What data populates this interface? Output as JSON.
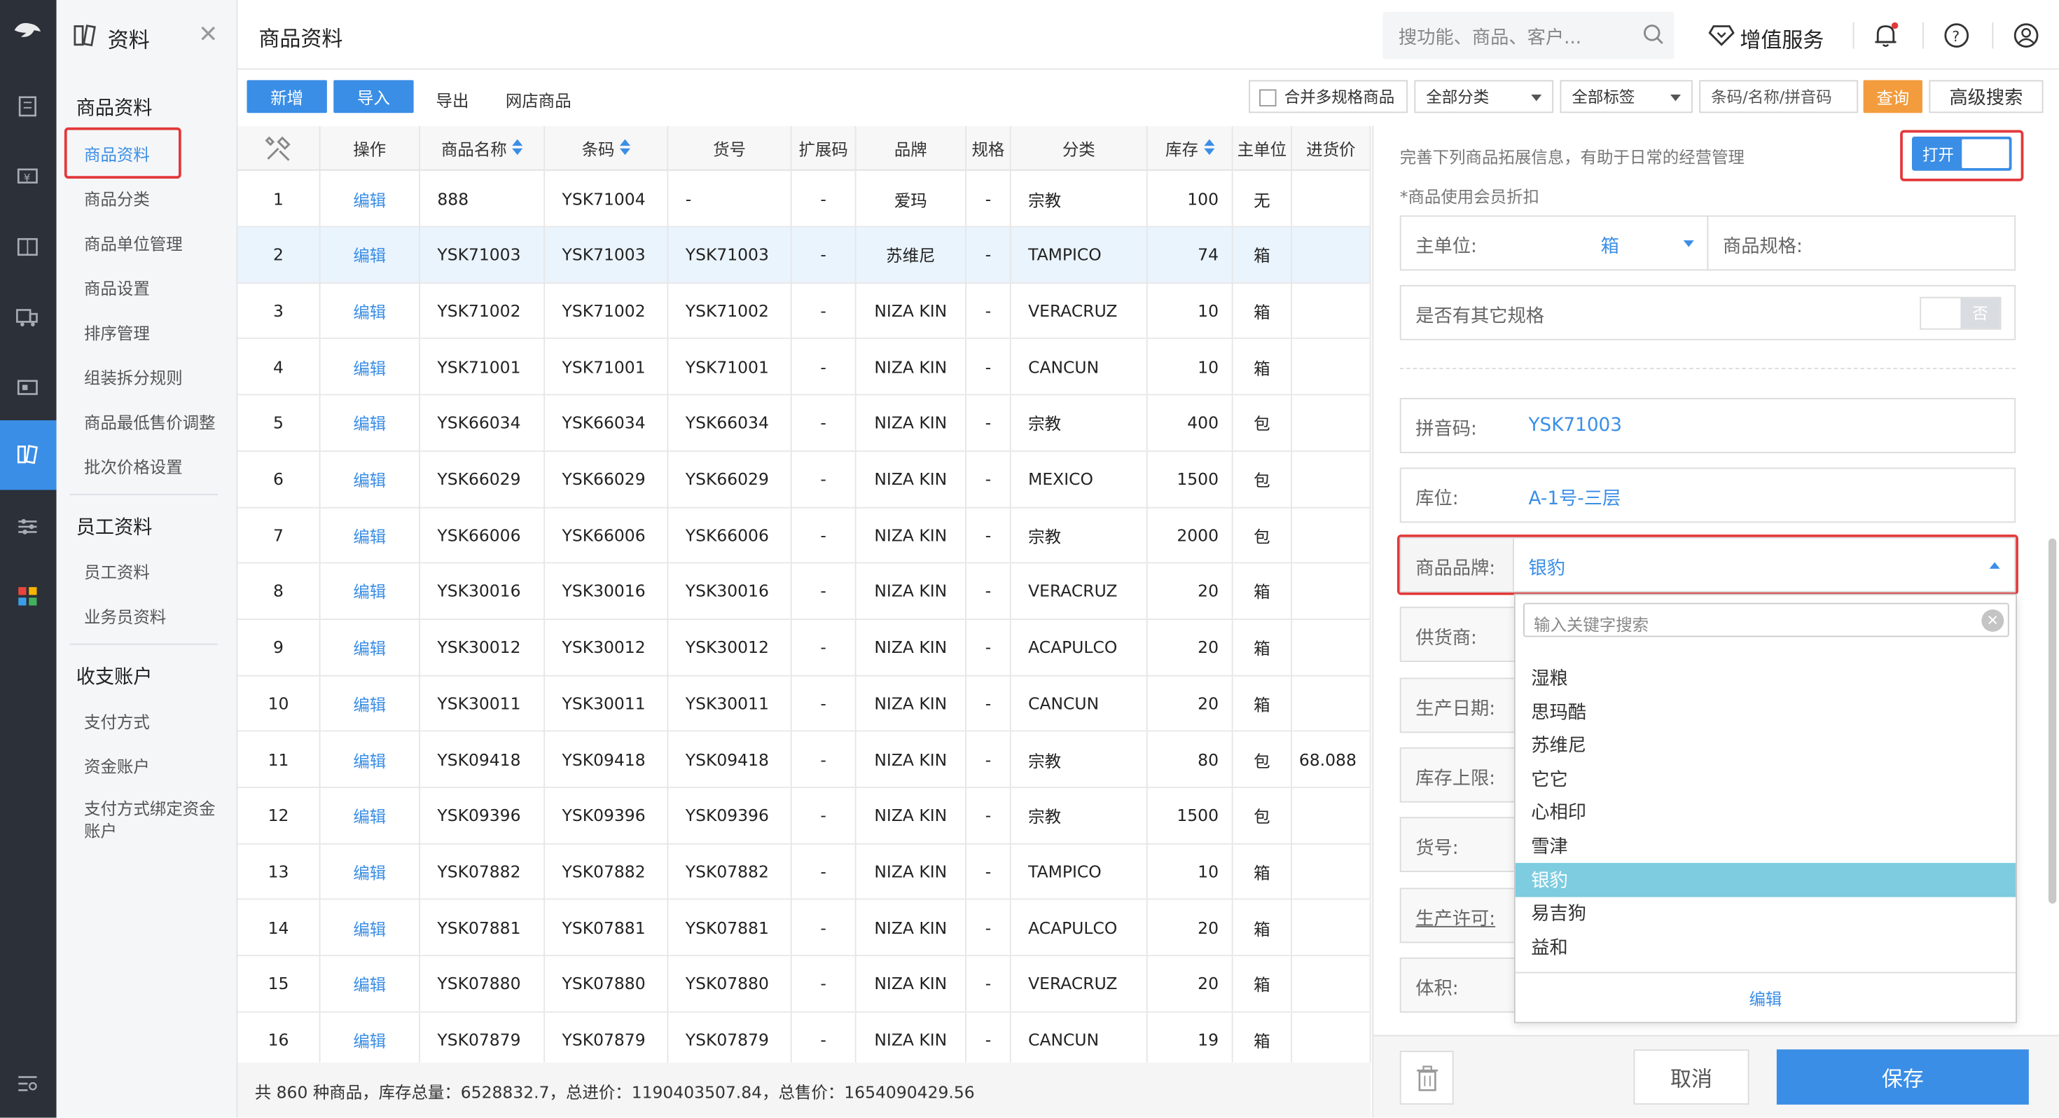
{
  "app": {
    "module_title": "资料",
    "page_title": "商品资料"
  },
  "sidebar": {
    "groups": [
      {
        "title": "商品资料",
        "items": [
          "商品资料",
          "商品分类",
          "商品单位管理",
          "商品设置",
          "排序管理",
          "组装拆分规则",
          "商品最低售价调整",
          "批次价格设置"
        ]
      },
      {
        "title": "员工资料",
        "items": [
          "员工资料",
          "业务员资料"
        ]
      },
      {
        "title": "收支账户",
        "items": [
          "支付方式",
          "资金账户",
          "支付方式绑定资金账户"
        ]
      }
    ],
    "active_item": "商品资料"
  },
  "header": {
    "search_placeholder": "搜功能、商品、客户...",
    "vip_label": "增值服务"
  },
  "toolbar": {
    "add": "新增",
    "import": "导入",
    "export": "导出",
    "shop_goods": "网店商品",
    "merge_spec_label": "合并多规格商品",
    "category_select": "全部分类",
    "tag_select": "全部标签",
    "search_placeholder": "条码/名称/拼音码",
    "query": "查询",
    "advanced": "高级搜索"
  },
  "table": {
    "columns": [
      "",
      "操作",
      "商品名称",
      "条码",
      "货号",
      "扩展码",
      "品牌",
      "规格",
      "分类",
      "库存",
      "主单位",
      "进货价"
    ],
    "rows": [
      [
        "1",
        "编辑",
        "888",
        "YSK71004",
        "-",
        "-",
        "爱玛",
        "-",
        "宗教",
        "100",
        "无",
        ""
      ],
      [
        "2",
        "编辑",
        "YSK71003",
        "YSK71003",
        "YSK71003",
        "-",
        "苏维尼",
        "-",
        "TAMPICO",
        "74",
        "箱",
        ""
      ],
      [
        "3",
        "编辑",
        "YSK71002",
        "YSK71002",
        "YSK71002",
        "-",
        "NIZA KIN",
        "-",
        "VERACRUZ",
        "10",
        "箱",
        ""
      ],
      [
        "4",
        "编辑",
        "YSK71001",
        "YSK71001",
        "YSK71001",
        "-",
        "NIZA KIN",
        "-",
        "CANCUN",
        "10",
        "箱",
        ""
      ],
      [
        "5",
        "编辑",
        "YSK66034",
        "YSK66034",
        "YSK66034",
        "-",
        "NIZA KIN",
        "-",
        "宗教",
        "400",
        "包",
        ""
      ],
      [
        "6",
        "编辑",
        "YSK66029",
        "YSK66029",
        "YSK66029",
        "-",
        "NIZA KIN",
        "-",
        "MEXICO",
        "1500",
        "包",
        ""
      ],
      [
        "7",
        "编辑",
        "YSK66006",
        "YSK66006",
        "YSK66006",
        "-",
        "NIZA KIN",
        "-",
        "宗教",
        "2000",
        "包",
        ""
      ],
      [
        "8",
        "编辑",
        "YSK30016",
        "YSK30016",
        "YSK30016",
        "-",
        "NIZA KIN",
        "-",
        "VERACRUZ",
        "20",
        "箱",
        ""
      ],
      [
        "9",
        "编辑",
        "YSK30012",
        "YSK30012",
        "YSK30012",
        "-",
        "NIZA KIN",
        "-",
        "ACAPULCO",
        "20",
        "箱",
        ""
      ],
      [
        "10",
        "编辑",
        "YSK30011",
        "YSK30011",
        "YSK30011",
        "-",
        "NIZA KIN",
        "-",
        "CANCUN",
        "20",
        "箱",
        ""
      ],
      [
        "11",
        "编辑",
        "YSK09418",
        "YSK09418",
        "YSK09418",
        "-",
        "NIZA KIN",
        "-",
        "宗教",
        "80",
        "包",
        "68.088"
      ],
      [
        "12",
        "编辑",
        "YSK09396",
        "YSK09396",
        "YSK09396",
        "-",
        "NIZA KIN",
        "-",
        "宗教",
        "1500",
        "包",
        ""
      ],
      [
        "13",
        "编辑",
        "YSK07882",
        "YSK07882",
        "YSK07882",
        "-",
        "NIZA KIN",
        "-",
        "TAMPICO",
        "10",
        "箱",
        ""
      ],
      [
        "14",
        "编辑",
        "YSK07881",
        "YSK07881",
        "YSK07881",
        "-",
        "NIZA KIN",
        "-",
        "ACAPULCO",
        "20",
        "箱",
        ""
      ],
      [
        "15",
        "编辑",
        "YSK07880",
        "YSK07880",
        "YSK07880",
        "-",
        "NIZA KIN",
        "-",
        "VERACRUZ",
        "20",
        "箱",
        ""
      ],
      [
        "16",
        "编辑",
        "YSK07879",
        "YSK07879",
        "YSK07879",
        "-",
        "NIZA KIN",
        "-",
        "CANCUN",
        "19",
        "箱",
        ""
      ]
    ],
    "selected_row": 2,
    "footer": "共 860 种商品，库存总量：6528832.7，总进价：1190403507.84，总售价：1654090429.56"
  },
  "panel": {
    "hint": "完善下列商品拓展信息，有助于日常的经营管理",
    "toggle_on_label": "打开",
    "member_note": "*商品使用会员折扣",
    "unit_label": "主单位:",
    "unit_value": "箱",
    "spec_label": "商品规格:",
    "other_spec_label": "是否有其它规格",
    "other_spec_toggle": "否",
    "pinyin_label": "拼音码:",
    "pinyin_value": "YSK71003",
    "location_label": "库位:",
    "location_value": "A-1号-三层",
    "brand_label": "商品品牌:",
    "brand_value": "银豹",
    "supplier_label": "供货商:",
    "prod_date_label": "生产日期:",
    "stock_max_label": "库存上限:",
    "item_no_label": "货号:",
    "license_label": "生产许可:",
    "volume_label": "体积:",
    "cancel": "取消",
    "save": "保存"
  },
  "brand_dropdown": {
    "search_placeholder": "输入关键字搜索",
    "options": [
      "湿粮",
      "思玛酷",
      "苏维尼",
      "它它",
      "心相印",
      "雪津",
      "银豹",
      "易吉狗",
      "益和"
    ],
    "highlighted": "银豹",
    "edit_label": "编辑"
  },
  "colors": {
    "accent": "#3a8ee6",
    "highlight": "#7dcce0",
    "query_button": "#f39c3d",
    "outline_red": "#e3383a"
  }
}
